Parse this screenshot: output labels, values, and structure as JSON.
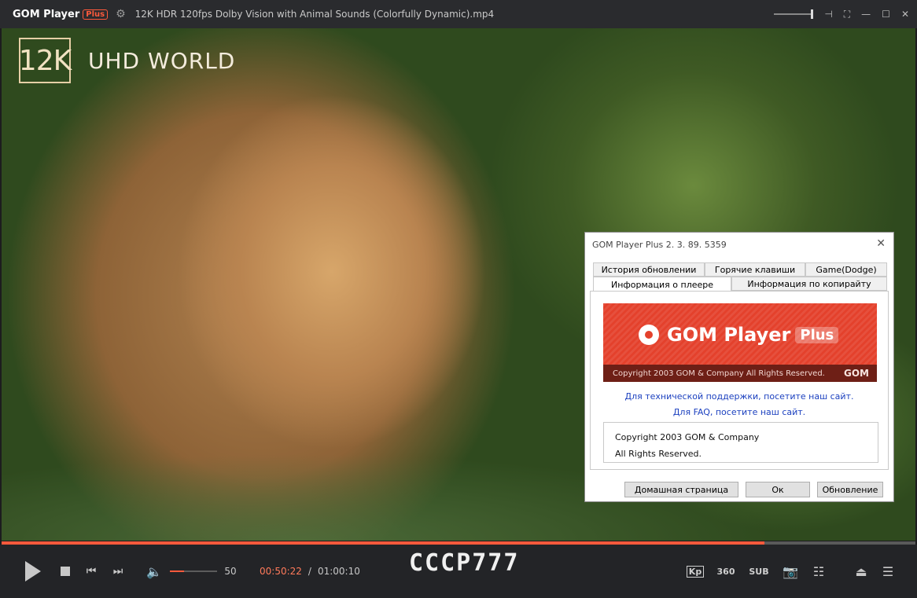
{
  "window": {
    "app_name": "GOM Player",
    "app_badge": "Plus",
    "file_title": "12K HDR 120fps Dolby Vision with Animal Sounds (Colorfully Dynamic).mp4"
  },
  "video": {
    "badge_text": "12K",
    "overlay_text": "UHD WORLD",
    "progress_fraction": 0.835
  },
  "controls": {
    "volume_value": "50",
    "volume_fraction": 0.3,
    "current_time": "00:50:22",
    "time_separator": "/",
    "total_time": "01:00:10",
    "watermark": "CCCP777",
    "kp_label": "Kp",
    "vr_label": "360",
    "sub_label": "SUB"
  },
  "dialog": {
    "title": "GOM Player Plus 2. 3. 89. 5359",
    "tabs_top": [
      "История обновлении",
      "Горячие клавиши",
      "Game(Dodge)"
    ],
    "tabs_bottom": [
      "Информация о плеере",
      "Информация по копирайту"
    ],
    "banner_title": "GOM Player",
    "banner_plus": "Plus",
    "banner_copyright": "Copyright 2003 GOM & Company All Rights Reserved.",
    "banner_gom": "GOM",
    "link_support": "Для технической поддержки, посетите наш сайт.",
    "link_faq": "Для FAQ, посетите наш сайт.",
    "copy_line1": "Copyright 2003 GOM & Company",
    "copy_line2": "All Rights Reserved.",
    "btn_home": "Домашная страница",
    "btn_ok": "Ок",
    "btn_update": "Обновление"
  }
}
